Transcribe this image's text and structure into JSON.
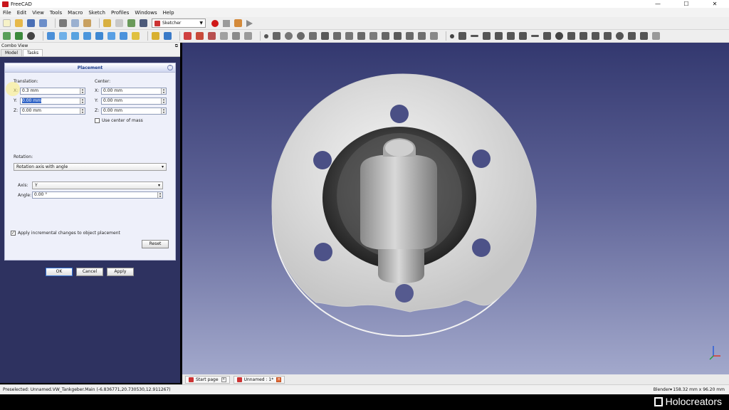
{
  "window": {
    "title": "FreeCAD",
    "controls": [
      "—",
      "☐",
      "✕"
    ]
  },
  "menu": [
    "File",
    "Edit",
    "View",
    "Tools",
    "Macro",
    "Sketch",
    "Profiles",
    "Windows",
    "Help"
  ],
  "workbench": {
    "selected": "Sketcher"
  },
  "combo_view": {
    "title": "Combo View",
    "tabs": [
      "Model",
      "Tasks"
    ],
    "active_tab": "Tasks"
  },
  "placement": {
    "title": "Placement",
    "translation_label": "Translation:",
    "center_label": "Center:",
    "translation": {
      "x_label": "X:",
      "x": "0.3 mm",
      "y_label": "Y:",
      "y": "0.00 mm",
      "z_label": "Z:",
      "z": "0.00 mm"
    },
    "center": {
      "x_label": "X:",
      "x": "0.00 mm",
      "y_label": "Y:",
      "y": "0.00 mm",
      "z_label": "Z:",
      "z": "0.00 mm"
    },
    "use_center_of_mass": {
      "label": "Use center of mass",
      "checked": false
    },
    "rotation_label": "Rotation:",
    "rotation_mode": "Rotation axis with angle",
    "axis_label": "Axis:",
    "axis": "Y",
    "angle_label": "Angle:",
    "angle": "0.00 °",
    "apply_incremental": {
      "label": "Apply incremental changes to object placement",
      "checked": true
    },
    "reset_label": "Reset"
  },
  "dialog_buttons": {
    "ok": "OK",
    "cancel": "Cancel",
    "apply": "Apply"
  },
  "document_tabs": [
    {
      "label": "Start page",
      "close": "×"
    },
    {
      "label": "Unnamed : 1*",
      "close": "×"
    }
  ],
  "statusbar": {
    "preselected": "Preselected: Unnamed.VW_Tankgeber.Main (-6.836771,20.730530,12.911267)",
    "navigation": "Blender▾",
    "dimensions": "158.32 mm x 96.20 mm"
  },
  "watermark": "Holocreators",
  "colors": {
    "viewport_top": "#33386f",
    "viewport_bottom": "#a3a9cc",
    "record": "#d01818",
    "selection": "#2f63c7"
  }
}
